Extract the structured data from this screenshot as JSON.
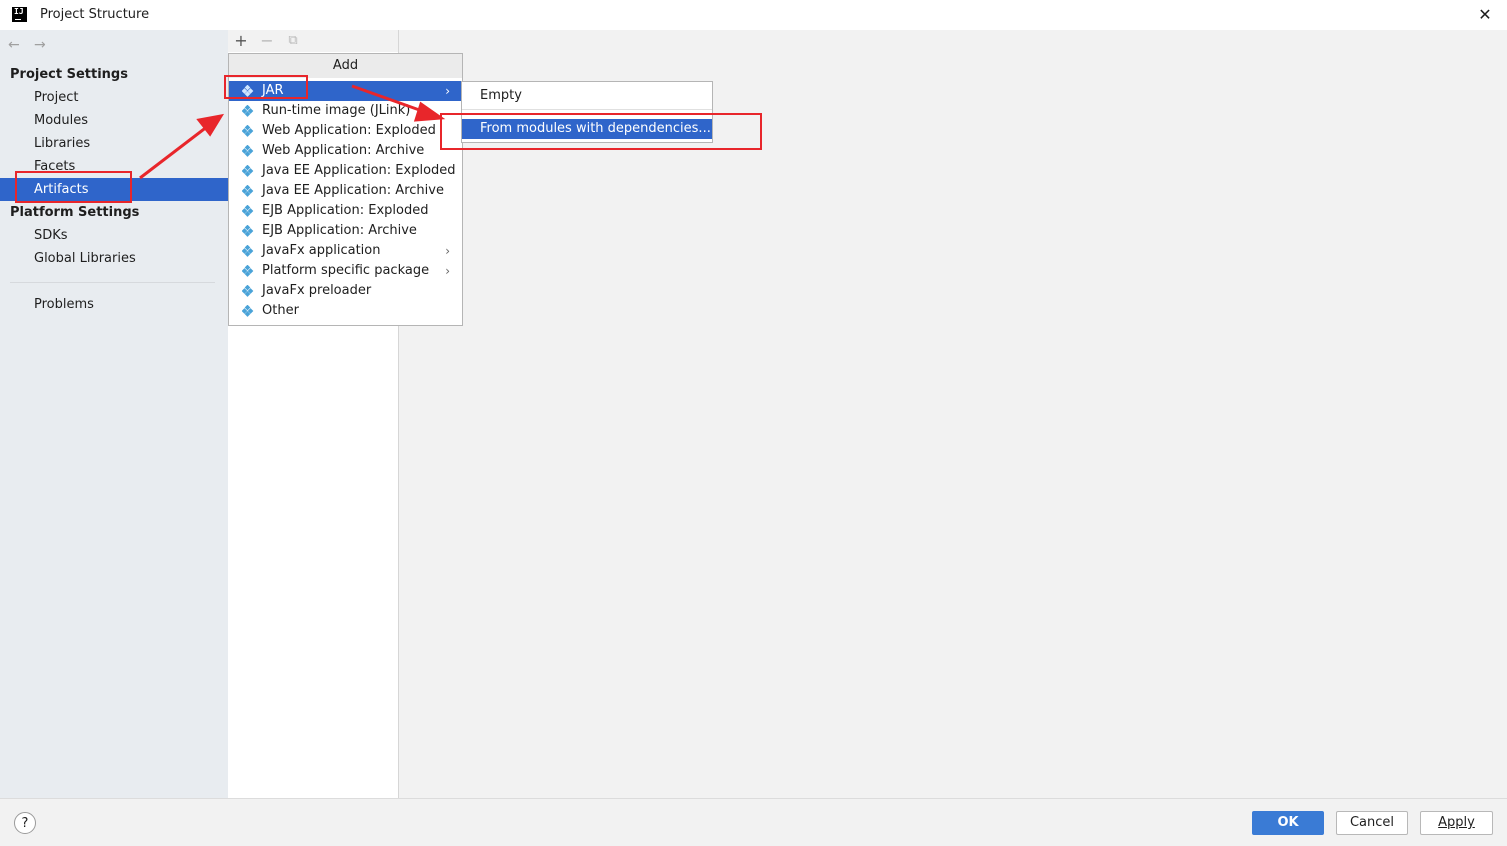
{
  "window": {
    "title": "Project Structure",
    "app_icon": "IJ",
    "close_glyph": "✕"
  },
  "nav": {
    "back": "←",
    "forward": "→"
  },
  "sidebar": {
    "project_settings_header": "Project Settings",
    "project_items": [
      "Project",
      "Modules",
      "Libraries",
      "Facets",
      "Artifacts"
    ],
    "selected": "Artifacts",
    "platform_settings_header": "Platform Settings",
    "platform_items": [
      "SDKs",
      "Global Libraries"
    ],
    "problems": "Problems"
  },
  "toolbar": {
    "add": "+",
    "remove": "−",
    "copy": "⧉"
  },
  "add_menu": {
    "header": "Add",
    "items": [
      {
        "label": "JAR",
        "submenu": true,
        "highlighted": true
      },
      {
        "label": "Run-time image (JLink)"
      },
      {
        "label": "Web Application: Exploded"
      },
      {
        "label": "Web Application: Archive"
      },
      {
        "label": "Java EE Application: Exploded"
      },
      {
        "label": "Java EE Application: Archive"
      },
      {
        "label": "EJB Application: Exploded"
      },
      {
        "label": "EJB Application: Archive"
      },
      {
        "label": "JavaFx application",
        "submenu": true
      },
      {
        "label": "Platform specific package",
        "submenu": true
      },
      {
        "label": "JavaFx preloader"
      },
      {
        "label": "Other"
      }
    ],
    "chevron": "›"
  },
  "jar_submenu": {
    "items": [
      "Empty",
      "From modules with dependencies..."
    ],
    "highlighted": "From modules with dependencies..."
  },
  "footer": {
    "help": "?",
    "ok": "OK",
    "cancel": "Cancel",
    "apply": "Apply"
  },
  "colors": {
    "selection": "#2f65ca",
    "annotation": "#e8262b",
    "ok_button": "#3a7bd5"
  }
}
